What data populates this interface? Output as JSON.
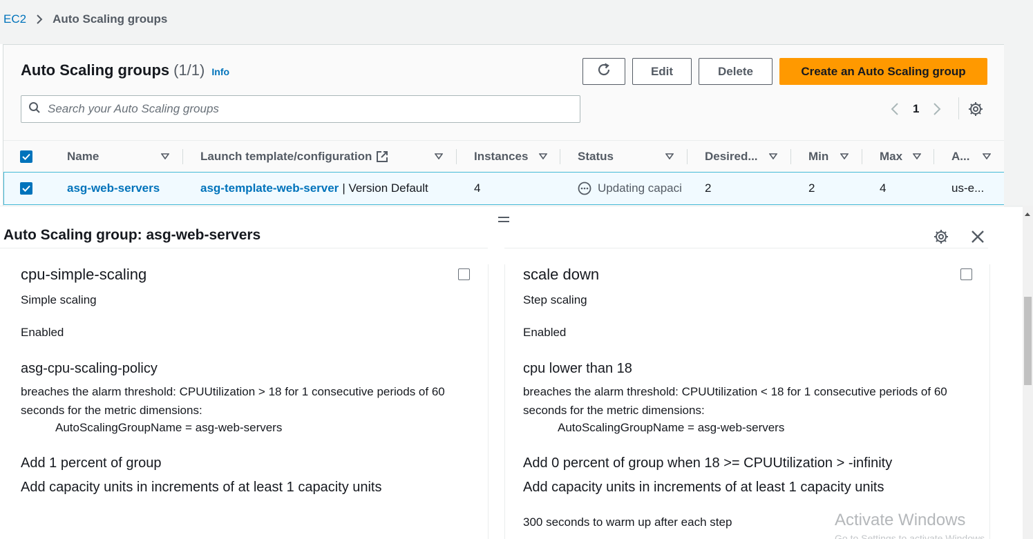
{
  "breadcrumb": {
    "root": "EC2",
    "current": "Auto Scaling groups"
  },
  "list": {
    "title": "Auto Scaling groups",
    "count": "(1/1)",
    "info": "Info",
    "buttons": {
      "edit": "Edit",
      "delete": "Delete",
      "create": "Create an Auto Scaling group"
    },
    "search_placeholder": "Search your Auto Scaling groups",
    "page": "1"
  },
  "table": {
    "columns": [
      "Name",
      "Launch template/configuration",
      "Instances",
      "Status",
      "Desired...",
      "Min",
      "Max",
      "A..."
    ],
    "rows": [
      {
        "name": "asg-web-servers",
        "template": "asg-template-web-server",
        "template_suffix": "| Version Default",
        "instances": "4",
        "status": "Updating capaci",
        "desired": "2",
        "min": "2",
        "max": "4",
        "az": "us-e..."
      }
    ]
  },
  "detail": {
    "title": "Auto Scaling group: asg-web-servers",
    "policies": [
      {
        "name": "cpu-simple-scaling",
        "type": "Simple scaling",
        "state": "Enabled",
        "alarm": "asg-cpu-scaling-policy",
        "alarm_desc": "breaches the alarm threshold: CPUUtilization > 18 for 1 consecutive periods of 60 seconds for the metric dimensions:",
        "dimension": "AutoScalingGroupName = asg-web-servers",
        "action": "Add 1 percent of group",
        "increment": "Add capacity units in increments of at least 1 capacity units"
      },
      {
        "name": "scale down",
        "type": "Step scaling",
        "state": "Enabled",
        "alarm": "cpu lower than 18",
        "alarm_desc": "breaches the alarm threshold: CPUUtilization < 18 for 1 consecutive periods of 60 seconds for the metric dimensions:",
        "dimension": "AutoScalingGroupName = asg-web-servers",
        "action": "Add 0 percent of group when 18 >= CPUUtilization > -infinity",
        "increment": "Add capacity units in increments of at least 1 capacity units",
        "warmup": "300 seconds to warm up after each step"
      }
    ]
  },
  "watermark": {
    "title": "Activate Windows",
    "subtitle": "Go to Settings to activate Windows."
  },
  "colors": {
    "primary_button": "#ff9900",
    "link": "#0073bb",
    "selected_row": "#f1faff",
    "selected_border": "#44b9d6"
  },
  "icons": [
    "chevron-right-icon",
    "refresh-icon",
    "search-icon",
    "chevron-left-icon",
    "gear-icon",
    "caret-down-icon",
    "external-link-icon",
    "checkmark-icon",
    "in-progress-icon",
    "drag-handle-icon",
    "close-icon"
  ]
}
